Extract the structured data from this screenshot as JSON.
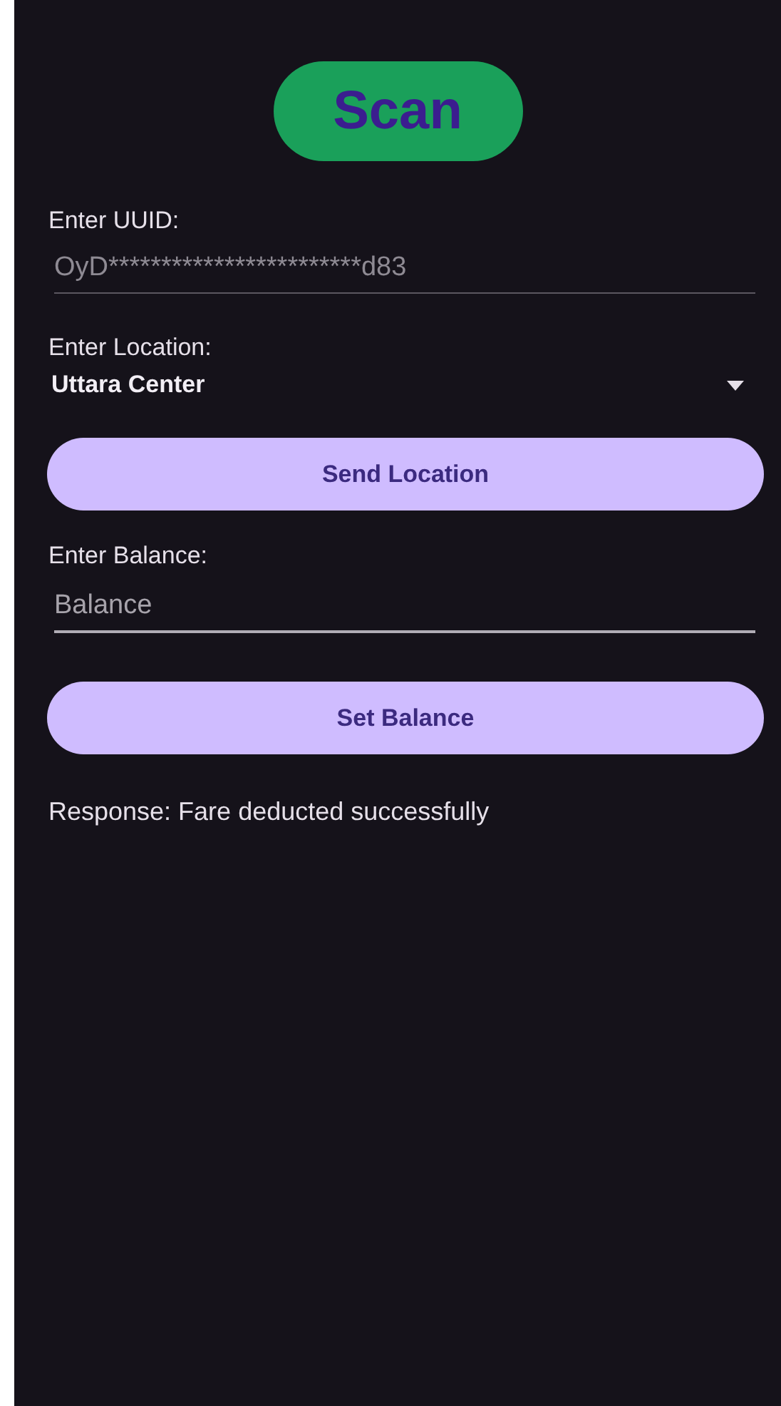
{
  "scan_button": {
    "label": "Scan"
  },
  "uuid": {
    "label": "Enter UUID:",
    "value": "OyD************************d83"
  },
  "location": {
    "label": "Enter Location:",
    "value": "Uttara Center"
  },
  "send_location_button": {
    "label": "Send Location"
  },
  "balance": {
    "label": "Enter Balance:",
    "placeholder": "Balance"
  },
  "set_balance_button": {
    "label": "Set Balance"
  },
  "response": "Response: Fare deducted successfully"
}
